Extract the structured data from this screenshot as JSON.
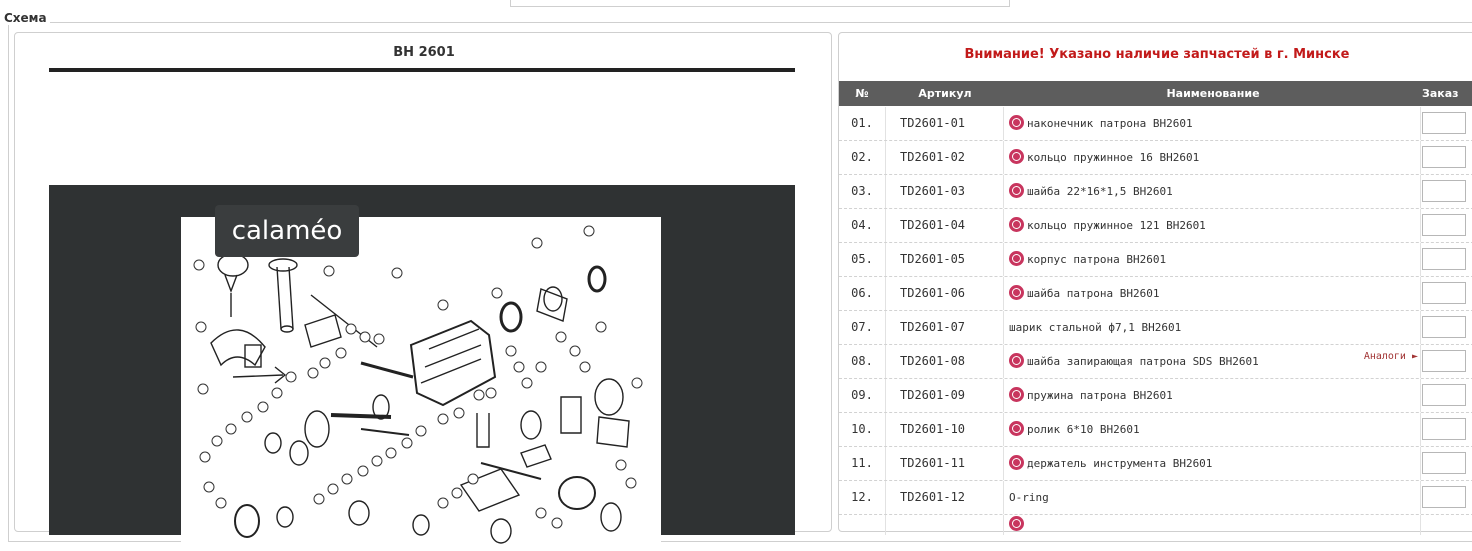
{
  "window": {
    "legend": "Схема"
  },
  "scheme": {
    "title": "BH 2601",
    "viewer_logo": "calaméo"
  },
  "parts": {
    "notice": "Внимание! Указано наличие запчастей в г. Минске",
    "columns": [
      "№",
      "Артикул",
      "Наименование",
      "Заказ"
    ],
    "rows": [
      {
        "num": "01.",
        "article": "TD2601-01",
        "name": "наконечник патрона BH2601",
        "in_stock": true,
        "analogs": ""
      },
      {
        "num": "02.",
        "article": "TD2601-02",
        "name": "кольцо пружинное 16 BH2601",
        "in_stock": true,
        "analogs": ""
      },
      {
        "num": "03.",
        "article": "TD2601-03",
        "name": "шайба 22*16*1,5 BH2601",
        "in_stock": true,
        "analogs": ""
      },
      {
        "num": "04.",
        "article": "TD2601-04",
        "name": "кольцо пружинное 121 BH2601",
        "in_stock": true,
        "analogs": ""
      },
      {
        "num": "05.",
        "article": "TD2601-05",
        "name": "корпус патрона BH2601",
        "in_stock": true,
        "analogs": ""
      },
      {
        "num": "06.",
        "article": "TD2601-06",
        "name": "шайба патрона BH2601",
        "in_stock": true,
        "analogs": ""
      },
      {
        "num": "07.",
        "article": "TD2601-07",
        "name": "шарик стальной ф7,1 BH2601",
        "in_stock": false,
        "analogs": ""
      },
      {
        "num": "08.",
        "article": "TD2601-08",
        "name": "шайба запирающая патрона SDS BH2601",
        "in_stock": true,
        "analogs": "Аналоги ►"
      },
      {
        "num": "09.",
        "article": "TD2601-09",
        "name": "пружина патрона BH2601",
        "in_stock": true,
        "analogs": ""
      },
      {
        "num": "10.",
        "article": "TD2601-10",
        "name": "ролик 6*10 BH2601",
        "in_stock": true,
        "analogs": ""
      },
      {
        "num": "11.",
        "article": "TD2601-11",
        "name": "держатель инструмента BH2601",
        "in_stock": true,
        "analogs": ""
      },
      {
        "num": "12.",
        "article": "TD2601-12",
        "name": "O-ring",
        "in_stock": false,
        "analogs": ""
      }
    ]
  },
  "colors": {
    "accent_red": "#c21a1a",
    "header_gray": "#5d5d5d",
    "stock_icon": "#c8355e"
  }
}
